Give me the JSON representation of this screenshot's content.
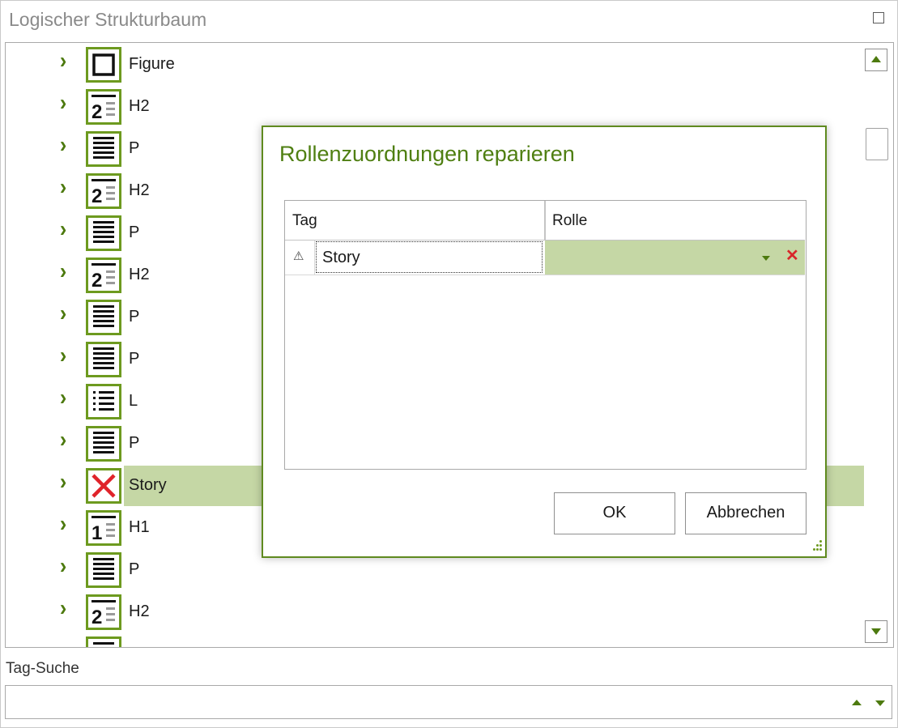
{
  "panel": {
    "title": "Logischer Strukturbaum"
  },
  "tree": {
    "rows": [
      {
        "label": "Figure",
        "icon": "figure-icon"
      },
      {
        "label": "H2",
        "icon": "heading-2-icon"
      },
      {
        "label": "P",
        "icon": "paragraph-icon"
      },
      {
        "label": "H2",
        "icon": "heading-2-icon"
      },
      {
        "label": "P",
        "icon": "paragraph-icon"
      },
      {
        "label": "H2",
        "icon": "heading-2-icon"
      },
      {
        "label": "P",
        "icon": "paragraph-icon"
      },
      {
        "label": "P",
        "icon": "paragraph-icon"
      },
      {
        "label": "L",
        "icon": "list-icon"
      },
      {
        "label": "P",
        "icon": "paragraph-icon"
      },
      {
        "label": "Story",
        "icon": "invalid-x-icon",
        "selected": true
      },
      {
        "label": "H1",
        "icon": "heading-1-icon"
      },
      {
        "label": "P",
        "icon": "paragraph-icon"
      },
      {
        "label": "H2",
        "icon": "heading-2-icon"
      },
      {
        "label": "",
        "icon": "paragraph-icon"
      }
    ]
  },
  "search": {
    "label": "Tag-Suche",
    "value": ""
  },
  "dialog": {
    "title": "Rollenzuordnungen reparieren",
    "columns": {
      "tag": "Tag",
      "role": "Rolle"
    },
    "rows": [
      {
        "tag": "Story",
        "role": "",
        "warning_icon": "warning-icon"
      }
    ],
    "ok_label": "OK",
    "cancel_label": "Abbrechen"
  },
  "colors": {
    "accent": "#5f8a1f",
    "selection": "#c5d7a5",
    "error": "#d8262a"
  }
}
